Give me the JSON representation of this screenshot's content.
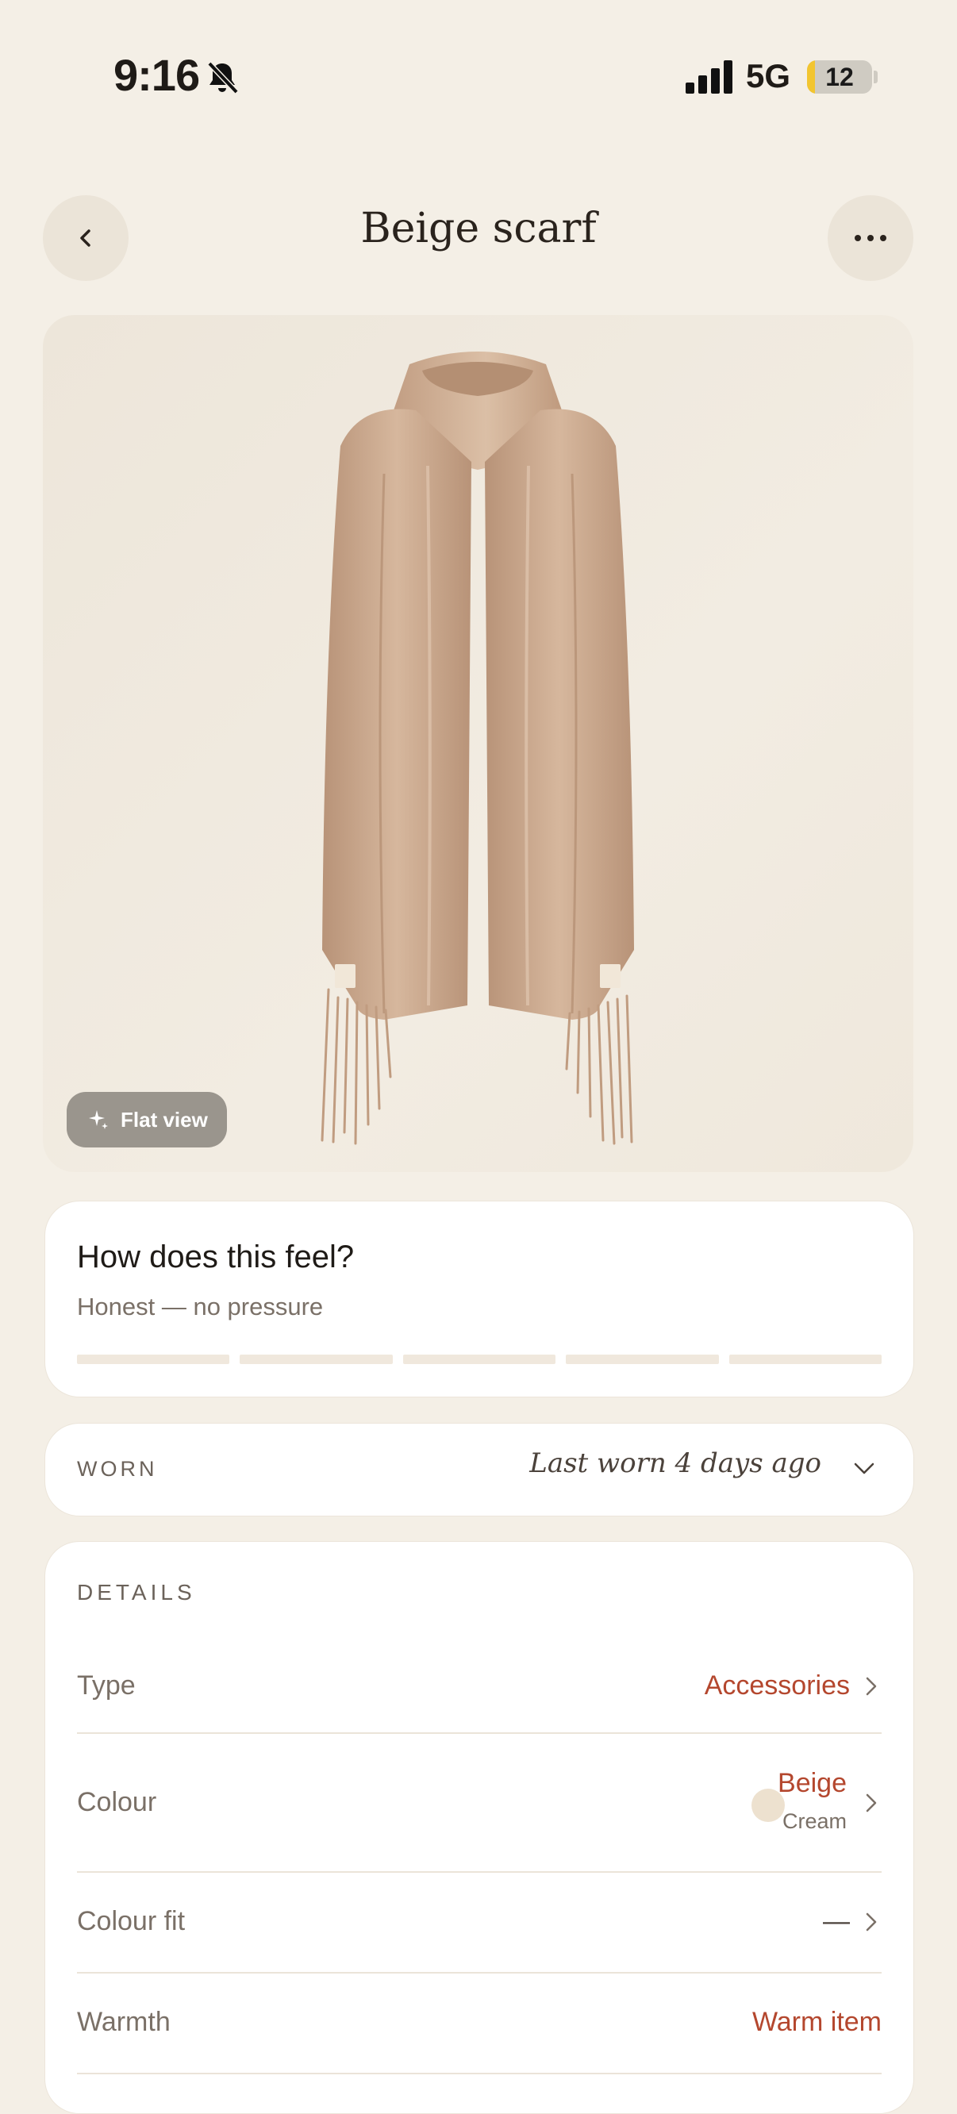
{
  "status_bar": {
    "time": "9:16",
    "network": "5G",
    "battery_level": "12",
    "battery_fraction": 0.12
  },
  "header": {
    "title": "Beige scarf",
    "back_icon": "chevron-left-icon",
    "more_icon": "ellipsis-icon"
  },
  "hero": {
    "badge_label": "Flat view",
    "badge_icon": "sparkle-icon"
  },
  "feel": {
    "title": "How does this feel?",
    "subtitle": "Honest — no pressure",
    "scale_steps": 5
  },
  "worn": {
    "label": "WORN",
    "value": "Last worn 4 days ago"
  },
  "details": {
    "label": "DETAILS",
    "rows": [
      {
        "label": "Type",
        "value": "Accessories"
      },
      {
        "label": "Colour",
        "value": "Beige",
        "sub": "Cream",
        "swatch_color": "#ede1cf"
      },
      {
        "label": "Colour fit",
        "value": "—"
      },
      {
        "label": "Warmth",
        "value": "Warm item"
      }
    ]
  },
  "colors": {
    "background": "#f4efe6",
    "accent": "#b4472e",
    "card": "#ffffff",
    "scarf": "#caa68a"
  }
}
